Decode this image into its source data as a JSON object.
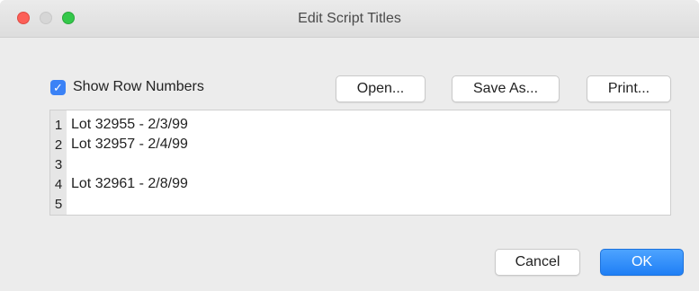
{
  "window": {
    "title": "Edit Script Titles"
  },
  "options": {
    "show_row_numbers_label": "Show Row Numbers",
    "show_row_numbers_checked": true
  },
  "toolbar": {
    "open_label": "Open...",
    "save_as_label": "Save As...",
    "print_label": "Print..."
  },
  "editor": {
    "lines": [
      {
        "num": "1",
        "text": "Lot 32955 - 2/3/99"
      },
      {
        "num": "2",
        "text": "Lot 32957 - 2/4/99"
      },
      {
        "num": "3",
        "text": ""
      },
      {
        "num": "4",
        "text": "Lot 32961 - 2/8/99"
      },
      {
        "num": "5",
        "text": ""
      }
    ]
  },
  "footer": {
    "cancel_label": "Cancel",
    "ok_label": "OK"
  },
  "colors": {
    "accent": "#1f7ff5",
    "close": "#fc5f57",
    "zoom": "#34c84a"
  }
}
